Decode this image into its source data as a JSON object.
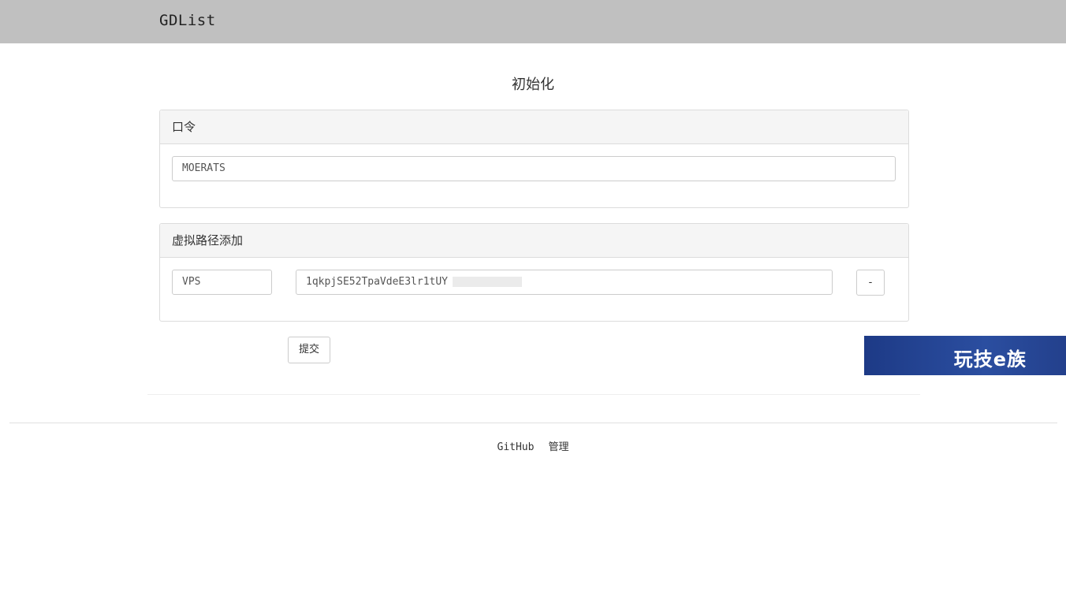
{
  "header": {
    "brand": "GDList"
  },
  "page": {
    "title": "初始化"
  },
  "password_panel": {
    "heading": "口令",
    "value": "MOERATS"
  },
  "path_panel": {
    "heading": "虚拟路径添加",
    "rows": [
      {
        "name_value": "VPS",
        "id_value": "1qkpjSE52TpaVdeE3lr1tUY",
        "remove_label": "-"
      }
    ]
  },
  "submit_label": "提交",
  "footer": {
    "links": [
      "GitHub",
      "管理"
    ]
  },
  "watermark": {
    "text": "玩技e族"
  },
  "colors": {
    "topbar": "#c0c0c0",
    "panel_heading": "#f5f5f5",
    "watermark": "#23408c"
  }
}
